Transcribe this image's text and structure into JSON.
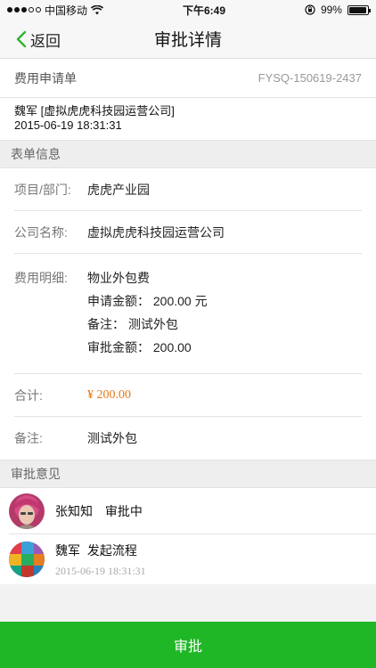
{
  "status_bar": {
    "carrier": "中国移动",
    "time": "下午6:49",
    "battery": "99%"
  },
  "nav": {
    "back_label": "返回",
    "title": "审批详情"
  },
  "document": {
    "type_label": "费用申请单",
    "number": "FYSQ-150619-2437",
    "applicant": "魏军 [虚拟虎虎科技园运营公司]",
    "date": "2015-06-19 18:31:31"
  },
  "form_section": {
    "title": "表单信息",
    "project_label": "项目/部门:",
    "project_value": "虎虎产业园",
    "company_label": "公司名称:",
    "company_value": "虚拟虎虎科技园运营公司",
    "detail_label": "费用明细:",
    "detail_lines": [
      "物业外包费",
      "申请金额： 200.00 元",
      "备注：  测试外包",
      "审批金额： 200.00"
    ],
    "total_label": "合计:",
    "total_value": "¥ 200.00",
    "remark_label": "备注:",
    "remark_value": "测试外包"
  },
  "opinion_section": {
    "title": "审批意见",
    "approvers": [
      {
        "name": "张知知",
        "status": "审批中",
        "time": ""
      },
      {
        "name": "魏军",
        "status": "发起流程",
        "time": "2015-06-19 18:31:31"
      }
    ]
  },
  "action": {
    "approve_label": "审批"
  },
  "colors": {
    "accent_green": "#20b726",
    "amount_orange": "#e67716"
  }
}
